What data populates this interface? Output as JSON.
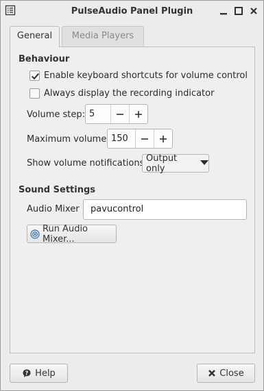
{
  "window": {
    "title": "PulseAudio Panel Plugin"
  },
  "tabs": [
    {
      "label": "General",
      "active": true
    },
    {
      "label": "Media Players",
      "active": false
    }
  ],
  "behaviour": {
    "heading": "Behaviour",
    "keyboard_shortcuts": {
      "label": "Enable keyboard shortcuts for volume control",
      "checked": true
    },
    "recording_indicator": {
      "label": "Always display the recording indicator",
      "checked": false
    },
    "volume_step": {
      "label": "Volume step:",
      "value": "5"
    },
    "max_volume": {
      "label": "Maximum volume:",
      "value": "150"
    },
    "notifications": {
      "label": "Show volume notifications:",
      "selected": "Output only"
    }
  },
  "sound_settings": {
    "heading": "Sound Settings",
    "audio_mixer_label": "Audio Mixer",
    "audio_mixer_value": "pavucontrol",
    "run_mixer_label": "Run Audio Mixer..."
  },
  "footer": {
    "help_label": "Help",
    "close_label": "Close"
  },
  "icons": {
    "window_menu": "window-menu-icon",
    "minimize": "minimize-icon",
    "maximize": "maximize-icon",
    "close": "close-icon",
    "help": "help-icon",
    "close_button": "close-x-icon",
    "run_mixer": "audio-mixer-icon"
  }
}
